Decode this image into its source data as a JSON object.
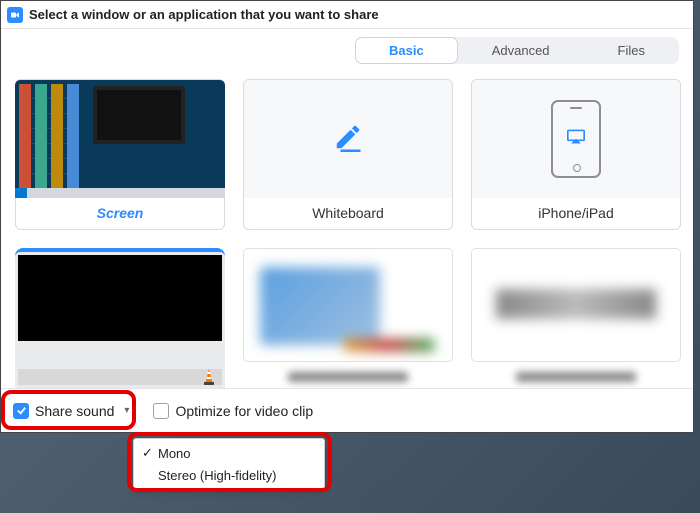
{
  "titlebar": {
    "text": "Select a window or an application that you want to share"
  },
  "tabs": {
    "basic": "Basic",
    "advanced": "Advanced",
    "files": "Files"
  },
  "cards": {
    "screen": "Screen",
    "whiteboard": "Whiteboard",
    "iphone_ipad": "iPhone/iPad"
  },
  "footer": {
    "share_sound": "Share sound",
    "optimize": "Optimize for video clip"
  },
  "dropdown": {
    "mono": "Mono",
    "stereo": "Stereo (High-fidelity)"
  },
  "colors": {
    "accent": "#2D8CFF",
    "highlight": "#e20000"
  }
}
